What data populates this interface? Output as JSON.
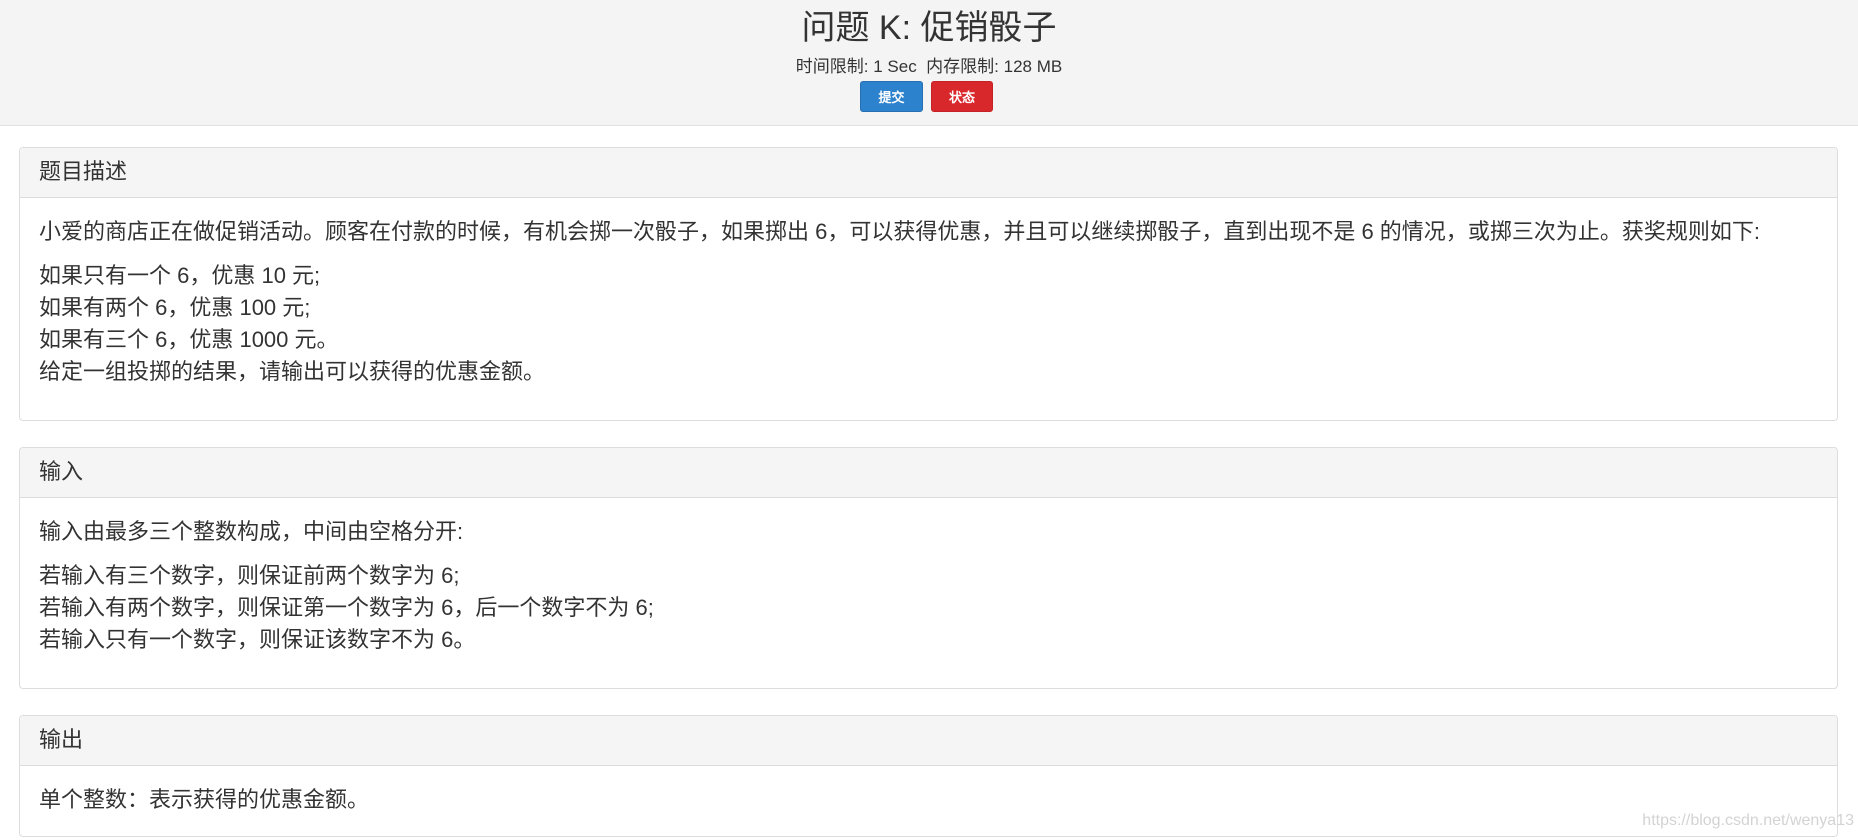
{
  "problem": {
    "title": "问题 K: 促销骰子",
    "time_limit_label": "时间限制:",
    "time_limit_value": "1 Sec",
    "memory_limit_label": "内存限制:",
    "memory_limit_value": "128 MB"
  },
  "buttons": {
    "submit_label": "提交",
    "status_label": "状态"
  },
  "sections": {
    "description": {
      "heading": "题目描述",
      "paragraph1": "小爱的商店正在做促销活动。顾客在付款的时候，有机会掷一次骰子，如果掷出 6，可以获得优惠，并且可以继续掷骰子，直到出现不是 6 的情况，或掷三次为止。获奖规则如下:",
      "lines": [
        "如果只有一个 6，优惠 10 元;",
        "如果有两个 6，优惠 100 元;",
        "如果有三个 6，优惠 1000 元。",
        "给定一组投掷的结果，请输出可以获得的优惠金额。"
      ]
    },
    "input": {
      "heading": "输入",
      "paragraph1": "输入由最多三个整数构成，中间由空格分开:",
      "lines": [
        "若输入有三个数字，则保证前两个数字为 6;",
        "若输入有两个数字，则保证第一个数字为 6，后一个数字不为 6;",
        "若输入只有一个数字，则保证该数字不为 6。"
      ]
    },
    "output": {
      "heading": "输出",
      "paragraph1": "单个整数：表示获得的优惠金额。"
    }
  },
  "watermark": "https://blog.csdn.net/wenya13",
  "colors": {
    "submit_button": "#2c82cc",
    "status_button": "#d9282c",
    "header_background": "#f4f4f4",
    "panel_heading_background": "#f5f5f5"
  }
}
